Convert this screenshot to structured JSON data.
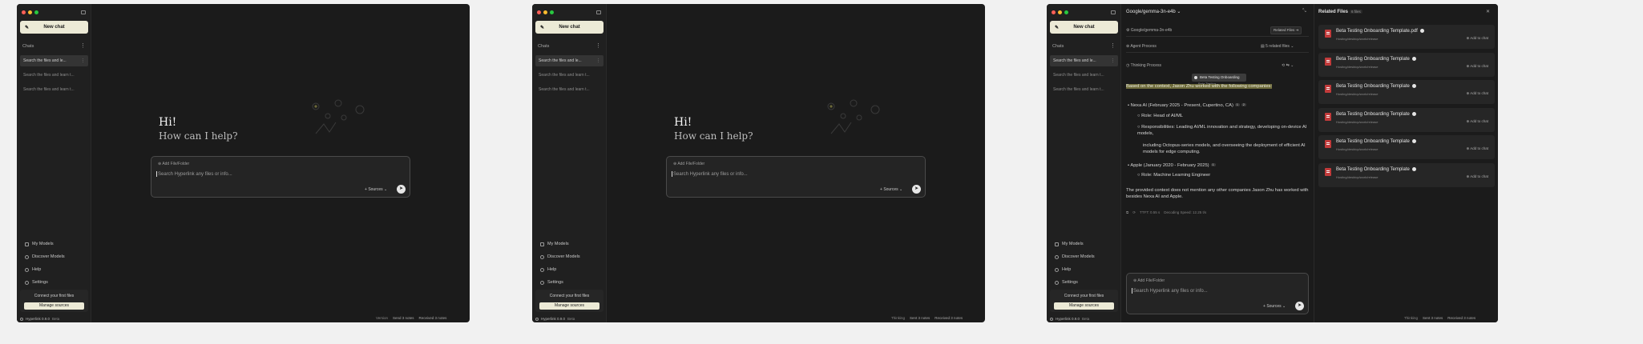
{
  "sidebar": {
    "new_chat": "New chat",
    "chats_heading": "Chats",
    "history": [
      "Search the files and le...",
      "Search the files and learn t...",
      "Search the files and learn t..."
    ],
    "nav": [
      "My Models",
      "Discover Models",
      "Help",
      "Settings"
    ],
    "connect_text": "Connect your first files",
    "manage_sources": "Manage sources",
    "version": "Hyperlink 0.9.0",
    "beta": "Beta"
  },
  "status": {
    "w1": [
      "Version",
      "Send 3 notes",
      "Received 3 notes"
    ],
    "w3": [
      "Thinking",
      "Sent 3 notes",
      "Received 3 notes"
    ]
  },
  "home": {
    "greeting": "Hi!",
    "subtitle": "How can I help?",
    "add_file": "Add File/Folder",
    "placeholder": "Search Hyperlink any files or info...",
    "sources": "Sources"
  },
  "chat": {
    "model": "Google/gemma-3n-e4b",
    "model_row": "Google/gemma-3n-e4b",
    "related_files_btn": "Related Files",
    "agent_process": "Agent Process",
    "related_files_count": "5 related files",
    "thinking_process": "Thinking Process",
    "tooltip": "Beta Testing Onboarding Template",
    "tooltip_sub": "Beta Testing...",
    "intro": "Based on the context, Jason Zhu worked with the following companies:",
    "nexa": "Nexa AI (February 2025 - Present, Cupertino, CA)",
    "nexa_b1": "Role: Head of AI/ML",
    "nexa_b2a": "Responsibilities: Leading AI/ML innovation and strategy, developing on-device AI models,",
    "nexa_b2b": "including Octopus-series models, and overseeing the deployment of efficient AI models for edge computing.",
    "apple": "Apple (January 2020 - February 2025)",
    "apple_b1": "Role: Machine Learning Engineer",
    "outro": "The provided context does not mention any other companies Jason Zhu has worked with besides Nexa AI and Apple.",
    "stats": [
      "TTFT: 0.55 s",
      "Decoding Speed: 12.25 t/s"
    ],
    "badges": [
      "1",
      "2",
      "1"
    ]
  },
  "related": {
    "title": "Related Files",
    "count": "6 files",
    "files": [
      {
        "name": "Beta Testing Onboarding Template.pdf",
        "path": "Hosting/desktop/work/release",
        "action": "Add to chat"
      },
      {
        "name": "Beta Testing Onboarding Template",
        "path": "Hosting/desktop/work/release",
        "action": "Add to chat"
      },
      {
        "name": "Beta Testing Onboarding Template",
        "path": "Hosting/desktop/work/release",
        "action": "Add to chat"
      },
      {
        "name": "Beta Testing Onboarding Template",
        "path": "Hosting/desktop/work/release",
        "action": "Add to chat"
      },
      {
        "name": "Beta Testing Onboarding Template",
        "path": "Hosting/desktop/work/release",
        "action": "Add to chat"
      },
      {
        "name": "Beta Testing Onboarding Template",
        "path": "Hosting/desktop/work/release",
        "action": "Add to chat"
      }
    ]
  }
}
